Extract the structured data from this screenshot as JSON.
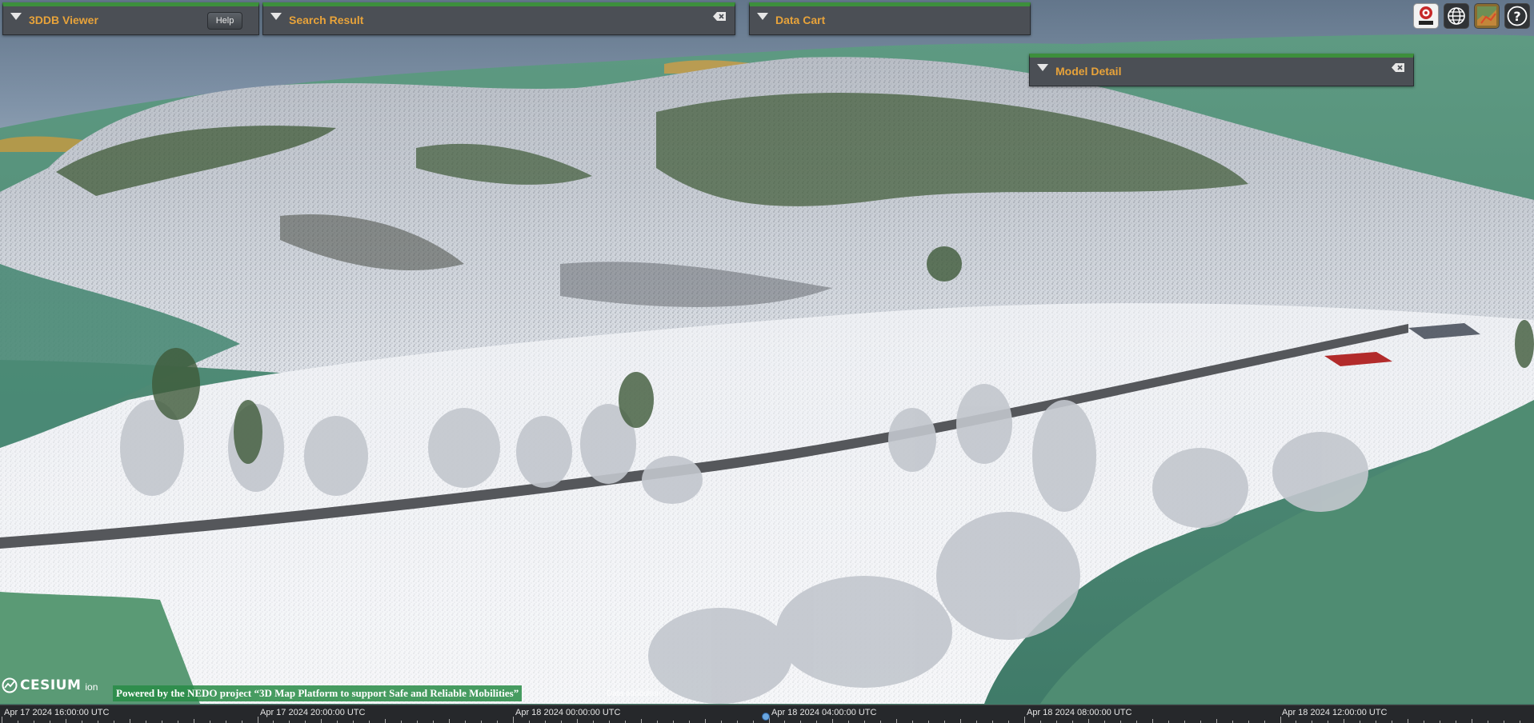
{
  "panels": {
    "viewer": {
      "title": "3DDB Viewer",
      "help_label": "Help"
    },
    "search": {
      "title": "Search Result",
      "close_icon": "close-icon"
    },
    "cart": {
      "title": "Data Cart"
    },
    "model": {
      "title": "Model Detail",
      "close_icon": "close-icon"
    }
  },
  "toolbar": {
    "items": [
      {
        "icon": "aist-logo-icon",
        "label": "AIST"
      },
      {
        "icon": "globe-icon"
      },
      {
        "icon": "map-icon"
      },
      {
        "icon": "help-icon",
        "label": "?"
      }
    ]
  },
  "credits": {
    "cesium_text": "CESIUM",
    "cesium_ion": "ion",
    "powered_by": "Powered by the NEDO project “3D Map Platform to support Safe and Reliable Mobilities”",
    "data_attribution": "Data attribution"
  },
  "timeline": {
    "labels": [
      "Apr 17 2024 16:00:00 UTC",
      "Apr 17 2024 20:00:00 UTC",
      "Apr 18 2024 00:00:00 UTC",
      "Apr 18 2024 04:00:00 UTC",
      "Apr 18 2024 08:00:00 UTC",
      "Apr 18 2024 12:00:00 UTC"
    ]
  },
  "colors": {
    "panel_bg": "#4b4f55",
    "panel_accent": "#3d8f3c",
    "title_color": "#e8a33a",
    "timeline_bg": "#26282b"
  }
}
